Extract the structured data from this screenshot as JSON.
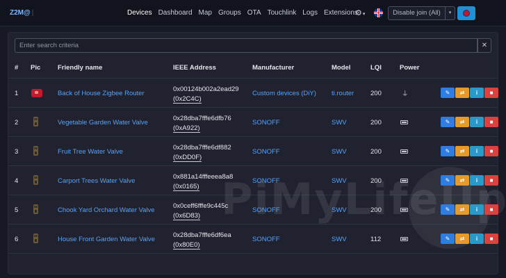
{
  "nav": {
    "brand": "Z2M@",
    "links": [
      "Devices",
      "Dashboard",
      "Map",
      "Groups",
      "OTA",
      "Touchlink",
      "Logs",
      "Extensions"
    ],
    "active": "Devices",
    "settings_icon": "gear-icon",
    "language_icon": "uk-flag-icon",
    "join_button": "Disable join (All)",
    "join_caret": "▾"
  },
  "search": {
    "placeholder": "Enter search criteria",
    "clear_label": "✕"
  },
  "table": {
    "headers": [
      "#",
      "Pic",
      "Friendly name",
      "IEEE Address",
      "Manufacturer",
      "Model",
      "LQI",
      "Power"
    ],
    "rows": [
      {
        "num": "1",
        "pic": "router",
        "name": "Back of House Zigbee Router",
        "ieee": "0x00124b002a2ead29",
        "nwk": "0x2C4C",
        "manufacturer": "Custom devices (DiY)",
        "model": "ti.router",
        "lqi": "200",
        "power": "mains"
      },
      {
        "num": "2",
        "pic": "valve",
        "name": "Vegetable Garden Water Valve",
        "ieee": "0x28dba7fffe6dfb76",
        "nwk": "0xA922",
        "manufacturer": "SONOFF",
        "model": "SWV",
        "lqi": "200",
        "power": "battery"
      },
      {
        "num": "3",
        "pic": "valve",
        "name": "Fruit Tree Water Valve",
        "ieee": "0x28dba7fffe6df882",
        "nwk": "0xDD0F",
        "manufacturer": "SONOFF",
        "model": "SWV",
        "lqi": "200",
        "power": "battery"
      },
      {
        "num": "4",
        "pic": "valve",
        "name": "Carport Trees Water Valve",
        "ieee": "0x881a14fffeeea8a8",
        "nwk": "0x0165",
        "manufacturer": "SONOFF",
        "model": "SWV",
        "lqi": "200",
        "power": "battery"
      },
      {
        "num": "5",
        "pic": "valve",
        "name": "Chook Yard Orchard Water Valve",
        "ieee": "0x0ceff6fffe9c445c",
        "nwk": "0x6D83",
        "manufacturer": "SONOFF",
        "model": "SWV",
        "lqi": "200",
        "power": "battery"
      },
      {
        "num": "6",
        "pic": "valve",
        "name": "House Front Garden Water Valve",
        "ieee": "0x28dba7fffe6df6ea",
        "nwk": "0x80E0",
        "manufacturer": "SONOFF",
        "model": "SWV",
        "lqi": "112",
        "power": "battery"
      }
    ],
    "actions": [
      {
        "name": "edit",
        "icon": "✎"
      },
      {
        "name": "rename",
        "icon": "⇄"
      },
      {
        "name": "info",
        "icon": "i"
      },
      {
        "name": "remove",
        "icon": "■"
      }
    ]
  },
  "watermark": "PiMyLifeUp",
  "colors": {
    "accent": "#5aa0f5",
    "edit": "#2f7de0",
    "rename": "#e69a2a",
    "info": "#2a98c8",
    "remove": "#d9433f"
  }
}
